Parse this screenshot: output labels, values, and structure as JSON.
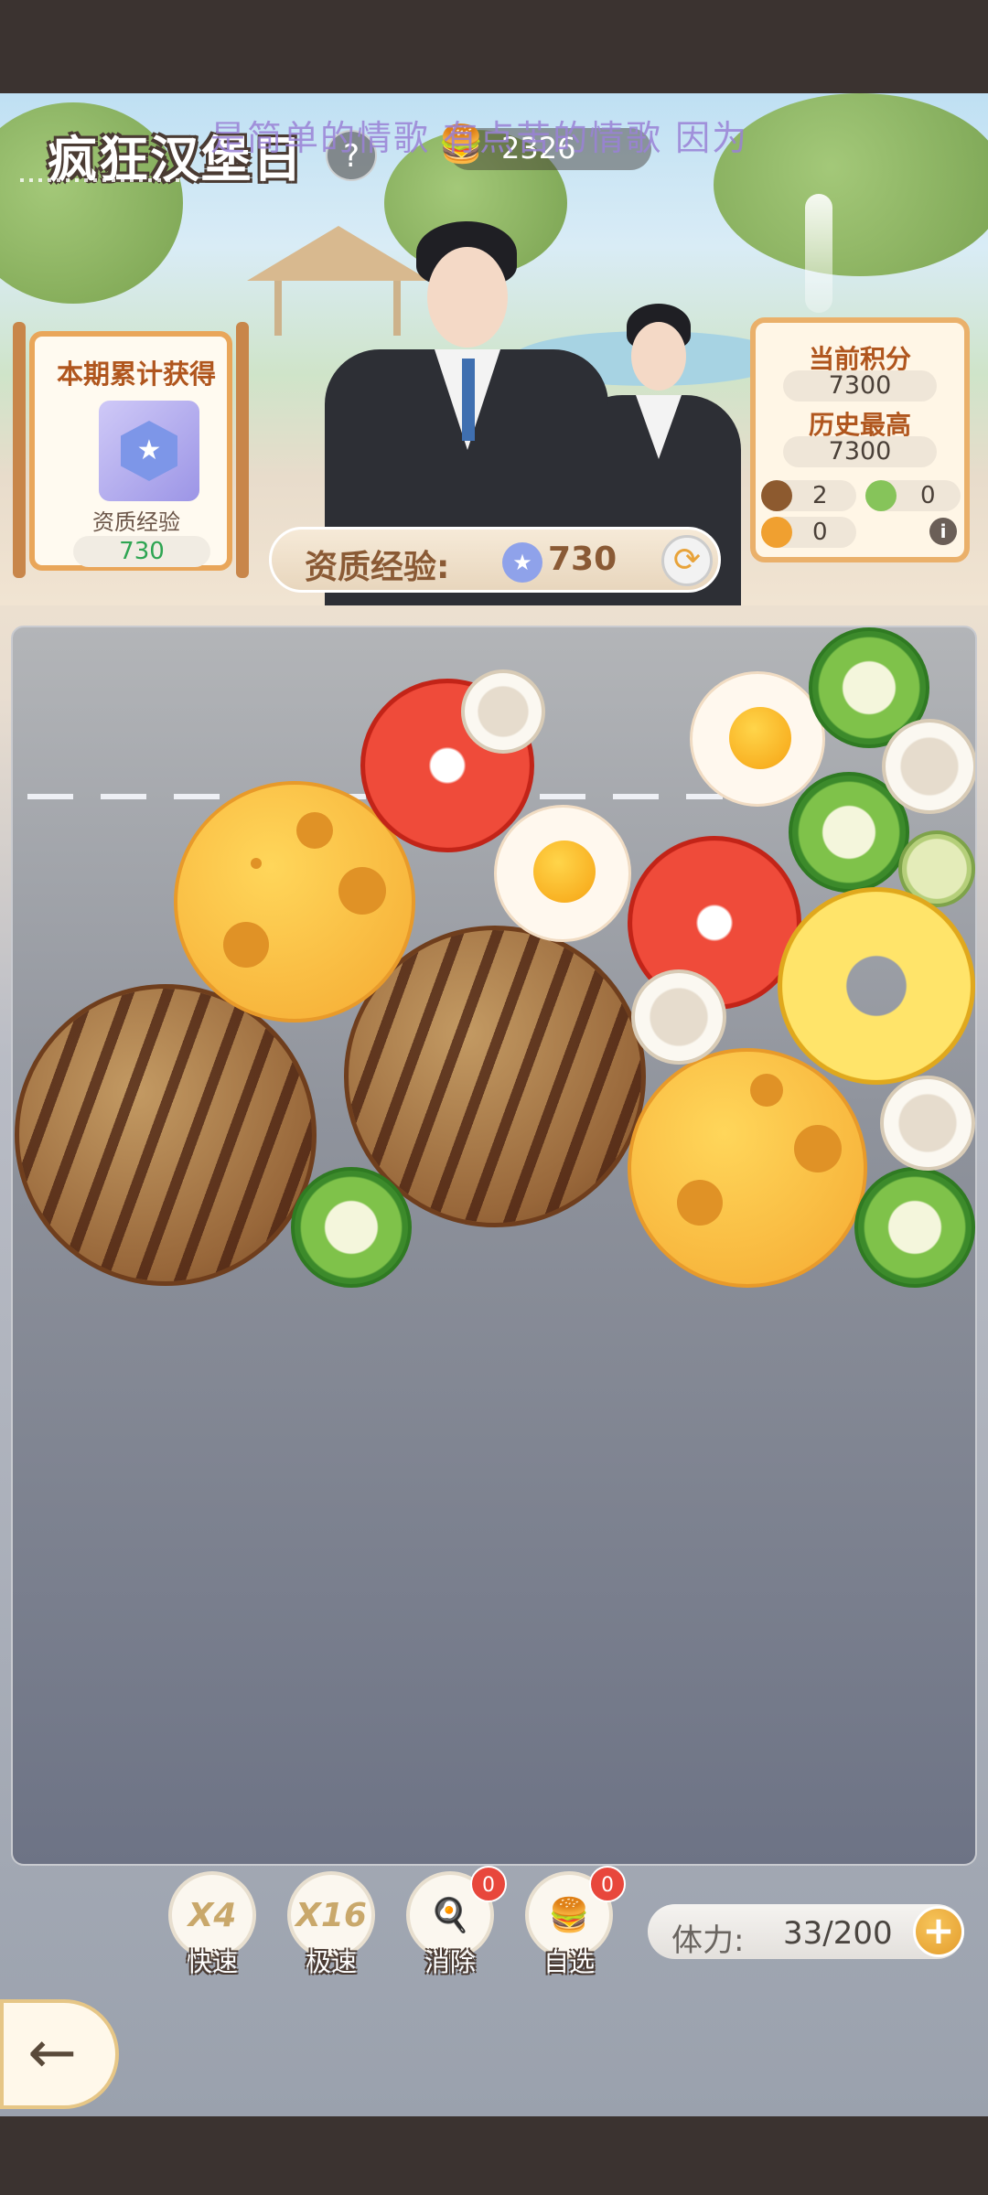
{
  "header": {
    "title": "疯狂汉堡日",
    "help_symbol": "?",
    "scrolling_lyric": "是简单的情歌 有点苦的情歌 因为",
    "coin_value": "2326"
  },
  "period_panel": {
    "title": "本期累计获得",
    "reward_label": "资质经验",
    "reward_value": "730"
  },
  "score_panel": {
    "current_label": "当前积分",
    "current_value": "7300",
    "best_label": "历史最高",
    "best_value": "7300",
    "ingredient_counts": [
      {
        "icon": "patty-icon",
        "value": "2"
      },
      {
        "icon": "lettuce-icon",
        "value": "0"
      },
      {
        "icon": "orange-icon",
        "value": "0"
      }
    ],
    "info_symbol": "i"
  },
  "xp_bar": {
    "label": "资质经验:",
    "value": "730"
  },
  "tools": [
    {
      "main": "X4",
      "label": "快速"
    },
    {
      "main": "X16",
      "label": "极速"
    },
    {
      "main": "",
      "label": "消除",
      "count": "0"
    },
    {
      "main": "",
      "label": "自选",
      "count": "0"
    }
  ],
  "stamina": {
    "label": "体力:",
    "value": "33/200",
    "plus_symbol": "+"
  },
  "back_symbol": "←",
  "colors": {
    "accent_orange": "#e9a65a",
    "xp_text": "#8a5a35",
    "reward_green": "#2ea552",
    "badge_red": "#e8473c"
  }
}
